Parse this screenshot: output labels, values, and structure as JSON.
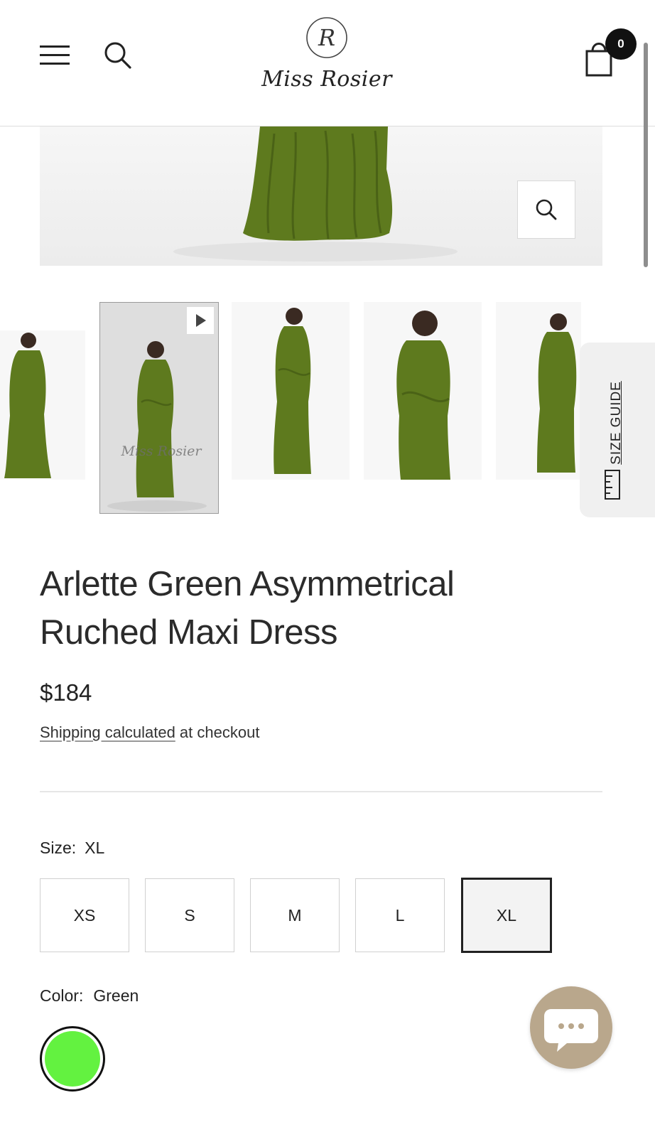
{
  "header": {
    "logo_monogram": "R",
    "logo_text": "Miss Rosier",
    "cart_count": "0",
    "icons": [
      "hamburger-menu-icon",
      "search-icon",
      "cart-icon"
    ]
  },
  "gallery": {
    "watermark": "Miss Rosier",
    "dress_color": "#5e7a1e",
    "thumbnail_count": 5,
    "selected_thumbnail": 1,
    "size_guide_label": "SIZE GUIDE"
  },
  "product": {
    "title": "Arlette Green Asymmetrical Ruched Maxi Dress",
    "price": "$184",
    "shipping_link": "Shipping calculated",
    "shipping_rest": " at checkout"
  },
  "options": {
    "size": {
      "label": "Size:",
      "selected": "XL",
      "values": [
        "XS",
        "S",
        "M",
        "L",
        "XL"
      ]
    },
    "color": {
      "label": "Color:",
      "selected": "Green",
      "swatch": "#63f240"
    }
  },
  "colors": {
    "text": "#222222",
    "chat_bubble": "#b9a78c"
  }
}
